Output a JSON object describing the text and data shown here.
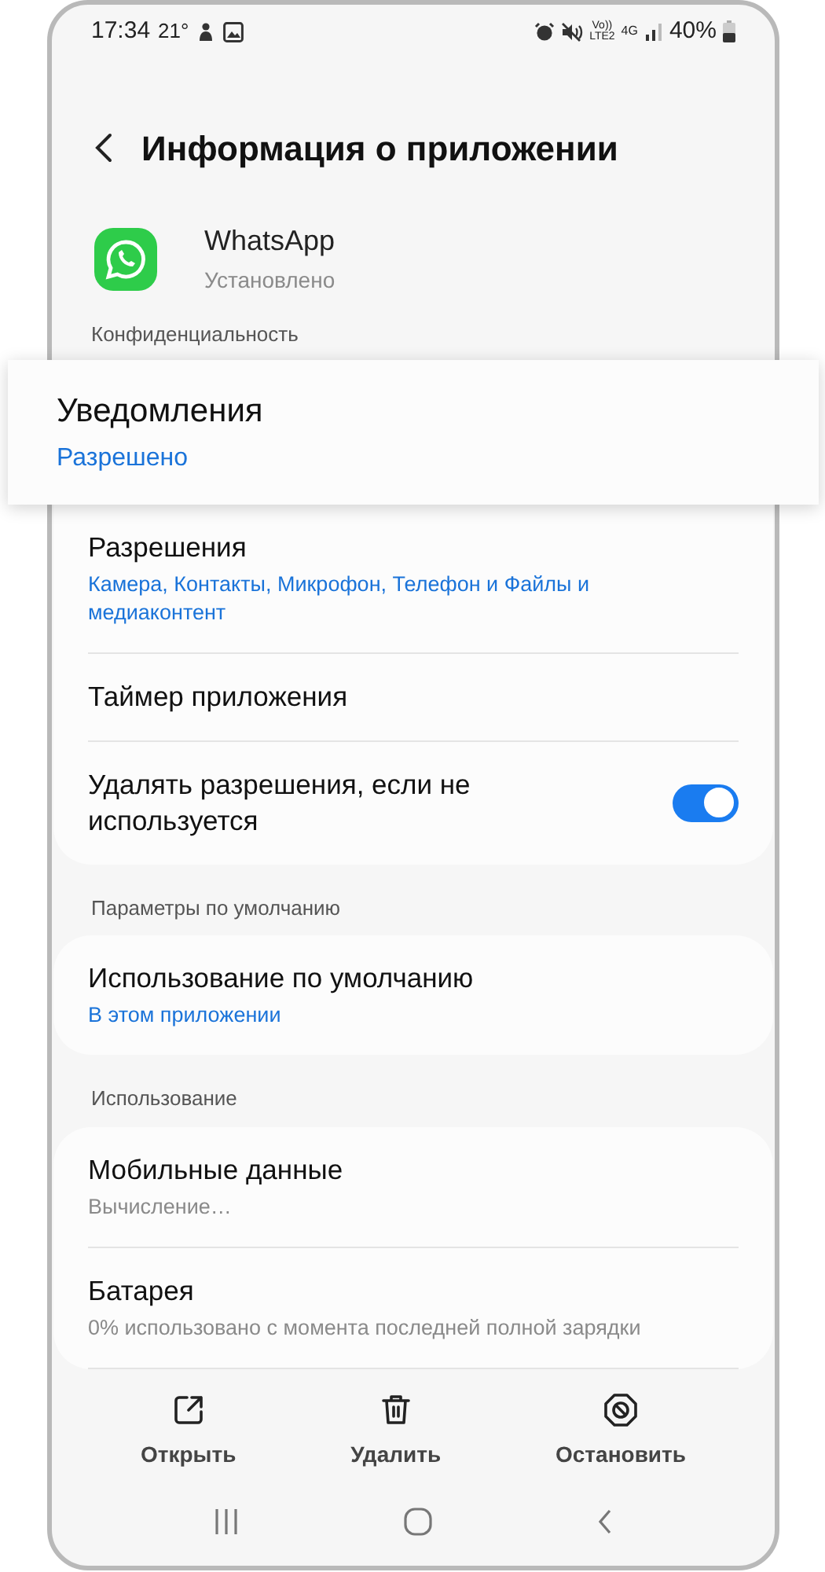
{
  "status_bar": {
    "time": "17:34",
    "temperature": "21°",
    "volte_top": "Vo))",
    "volte_bottom": "LTE2",
    "network": "4G",
    "battery": "40%"
  },
  "header": {
    "title": "Информация о приложении"
  },
  "app": {
    "name": "WhatsApp",
    "status": "Установлено"
  },
  "sections": [
    {
      "header": "Конфиденциальность",
      "items": [
        {
          "kind": "value",
          "title": "Уведомления",
          "subtitle": "Разрешено",
          "highlighted": true
        },
        {
          "kind": "value",
          "title": "Разрешения",
          "subtitle": "Камера, Контакты, Микрофон, Телефон и Файлы и медиаконтент",
          "highlighted": false
        },
        {
          "kind": "plain",
          "title": "Таймер приложения",
          "highlighted": false
        },
        {
          "kind": "toggle",
          "title": "Удалять разрешения, если не используется",
          "on": true,
          "highlighted": false
        }
      ]
    },
    {
      "header": "Параметры по умолчанию",
      "items": [
        {
          "kind": "value",
          "title": "Использование по умолчанию",
          "subtitle": "В этом приложении",
          "highlighted": false
        }
      ]
    },
    {
      "header": "Использование",
      "items": [
        {
          "kind": "info",
          "title": "Мобильные данные",
          "subtitle": "Вычисление…",
          "highlighted": false
        },
        {
          "kind": "info",
          "title": "Батарея",
          "subtitle": "0% использовано с момента последней полной зарядки",
          "highlighted": false
        }
      ]
    }
  ],
  "actions": [
    {
      "kind": "open",
      "label": "Открыть"
    },
    {
      "kind": "delete",
      "label": "Удалить"
    },
    {
      "kind": "stop",
      "label": "Остановить"
    }
  ]
}
